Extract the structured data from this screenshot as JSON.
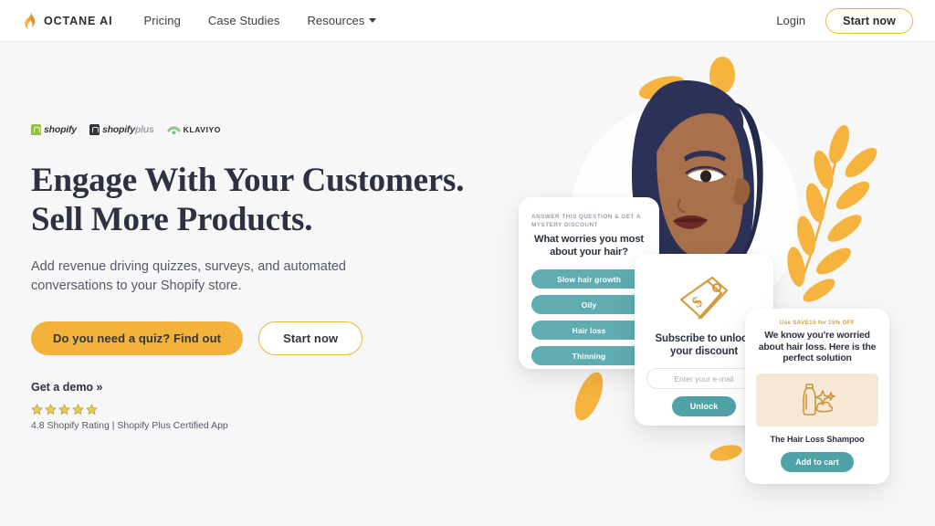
{
  "colors": {
    "accent_orange": "#f2b23c",
    "teal": "#5fadb0",
    "teal_dark": "#4fa3a6",
    "navy_text": "#2d3142",
    "page_bg": "#f7f7f7",
    "hair_navy": "#2b3157",
    "skin": "#a9714b",
    "star_gold": "#d6ab3c"
  },
  "header": {
    "brand": "OCTANE AI",
    "logo_icon": "flame-icon",
    "nav": [
      {
        "label": "Pricing",
        "has_caret": false
      },
      {
        "label": "Case Studies",
        "has_caret": false
      },
      {
        "label": "Resources",
        "has_caret": true
      }
    ],
    "login_label": "Login",
    "start_now_label": "Start now"
  },
  "hero": {
    "partners": [
      {
        "name": "shopify",
        "icon": "shopify-bag-icon"
      },
      {
        "name": "shopify",
        "suffix": "plus",
        "icon": "shopify-bag-icon"
      },
      {
        "name": "KLAVIYO",
        "icon": "klaviyo-icon"
      }
    ],
    "headline_line1": "Engage With Your Customers.",
    "headline_line2": "Sell More Products.",
    "subhead": "Add revenue driving quizzes, surveys, and automated conversations to your Shopify store.",
    "cta_primary": "Do you need a quiz? Find out",
    "cta_secondary": "Start now",
    "demo_link": "Get a demo »",
    "stars": 5,
    "rating_text": "4.8 Shopify Rating | Shopify Plus Certified App"
  },
  "quiz_card": {
    "kicker": "ANSWER THIS QUESTION & GET A MYSTERY DISCOUNT",
    "question": "What worries you most about your hair?",
    "options": [
      "Slow hair growth",
      "Oily",
      "Hair loss",
      "Thinning"
    ]
  },
  "subscribe_card": {
    "icon": "price-tag-icon",
    "title": "Subscribe to unlock your discount",
    "email_placeholder": "Enter your e-mail",
    "button_label": "Unlock"
  },
  "product_card": {
    "kicker": "Use SAVE15 for 15% OFF",
    "headline": "We know you're worried about hair loss. Here is the perfect solution",
    "product_icon": "shampoo-bottle-icon",
    "product_name": "The Hair Loss Shampoo",
    "button_label": "Add to cart"
  }
}
